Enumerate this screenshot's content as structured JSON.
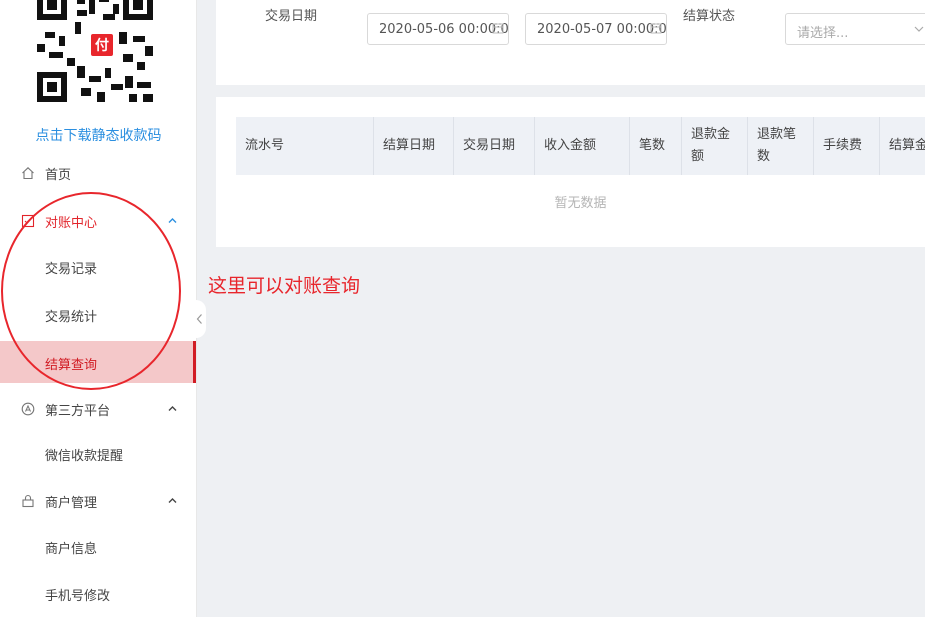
{
  "sidebar": {
    "download_link": "点击下载静态收款码",
    "qr_logo": "付",
    "menu": [
      {
        "label": "首页",
        "icon": "home-icon"
      },
      {
        "label": "对账中心",
        "icon": "reconcile-icon",
        "expanded": true,
        "children": [
          {
            "label": "交易记录"
          },
          {
            "label": "交易统计"
          },
          {
            "label": "结算查询",
            "active": true
          }
        ]
      },
      {
        "label": "第三方平台",
        "icon": "platform-icon",
        "expanded": true,
        "children": [
          {
            "label": "微信收款提醒"
          }
        ]
      },
      {
        "label": "商户管理",
        "icon": "merchant-icon",
        "expanded": true,
        "children": [
          {
            "label": "商户信息"
          },
          {
            "label": "手机号修改"
          }
        ]
      }
    ]
  },
  "filters": {
    "date_label": "交易日期",
    "start_date": "2020-05-06 00:00:0",
    "end_date": "2020-05-07 00:00:0",
    "status_label": "结算状态",
    "status_placeholder": "请选择..."
  },
  "table": {
    "columns": [
      "流水号",
      "结算日期",
      "交易日期",
      "收入金额",
      "笔数",
      "退款金\n额",
      "退款笔\n数",
      "手续费",
      "结算金"
    ],
    "empty_text": "暂无数据"
  },
  "annotation": {
    "text": "这里可以对账查询"
  },
  "colors": {
    "accent": "#e2242b",
    "link": "#2b8fe0",
    "active_bg": "#f4c8c9"
  }
}
